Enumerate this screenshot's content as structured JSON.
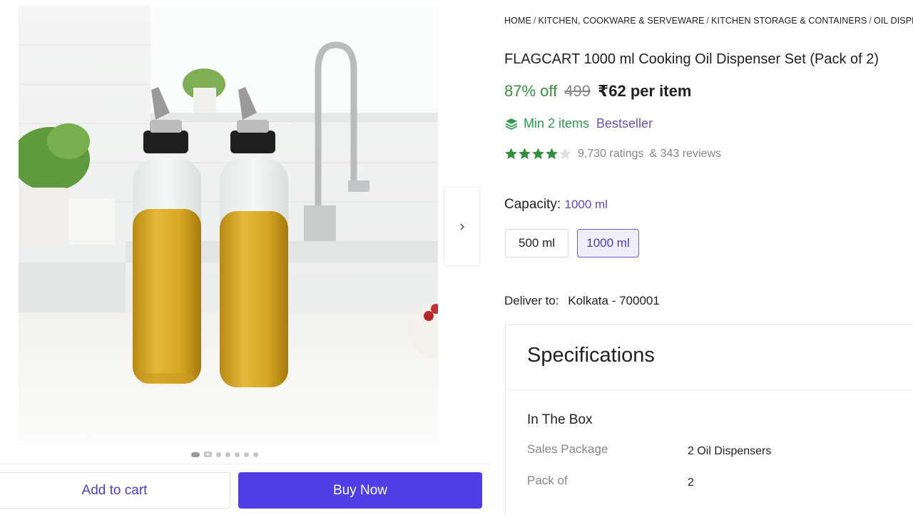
{
  "gallery": {
    "dots_count": 7,
    "active_dot": 0
  },
  "actions": {
    "add_to_cart": "Add to cart",
    "buy_now": "Buy Now"
  },
  "breadcrumb": [
    "HOME",
    "KITCHEN, COOKWARE & SERVEWARE",
    "KITCHEN STORAGE & CONTAINERS",
    "OIL DISPENSERS"
  ],
  "product": {
    "title": "FLAGCART 1000 ml Cooking Oil Dispenser Set (Pack of 2)",
    "discount": "87% off",
    "mrp": "499",
    "price": "₹62 per item",
    "min_items": "Min 2 items",
    "badge": "Bestseller",
    "rating_stars": 4,
    "ratings": "9,730 ratings",
    "reviews": "& 343 reviews"
  },
  "capacity": {
    "label": "Capacity:",
    "selected": "1000 ml",
    "options": [
      "500 ml",
      "1000 ml"
    ]
  },
  "delivery": {
    "label": "Deliver to:",
    "location": "Kolkata - 700001"
  },
  "specifications": {
    "heading": "Specifications",
    "group": "In The Box",
    "rows": [
      {
        "key": "Sales Package",
        "value": "2 Oil Dispensers"
      },
      {
        "key": "Pack of",
        "value": "2"
      }
    ]
  },
  "colors": {
    "accent": "#4e3ee6",
    "discount_green": "#388e3c",
    "bestseller_purple": "#6b54b6",
    "star_green": "#2f8f3a"
  }
}
